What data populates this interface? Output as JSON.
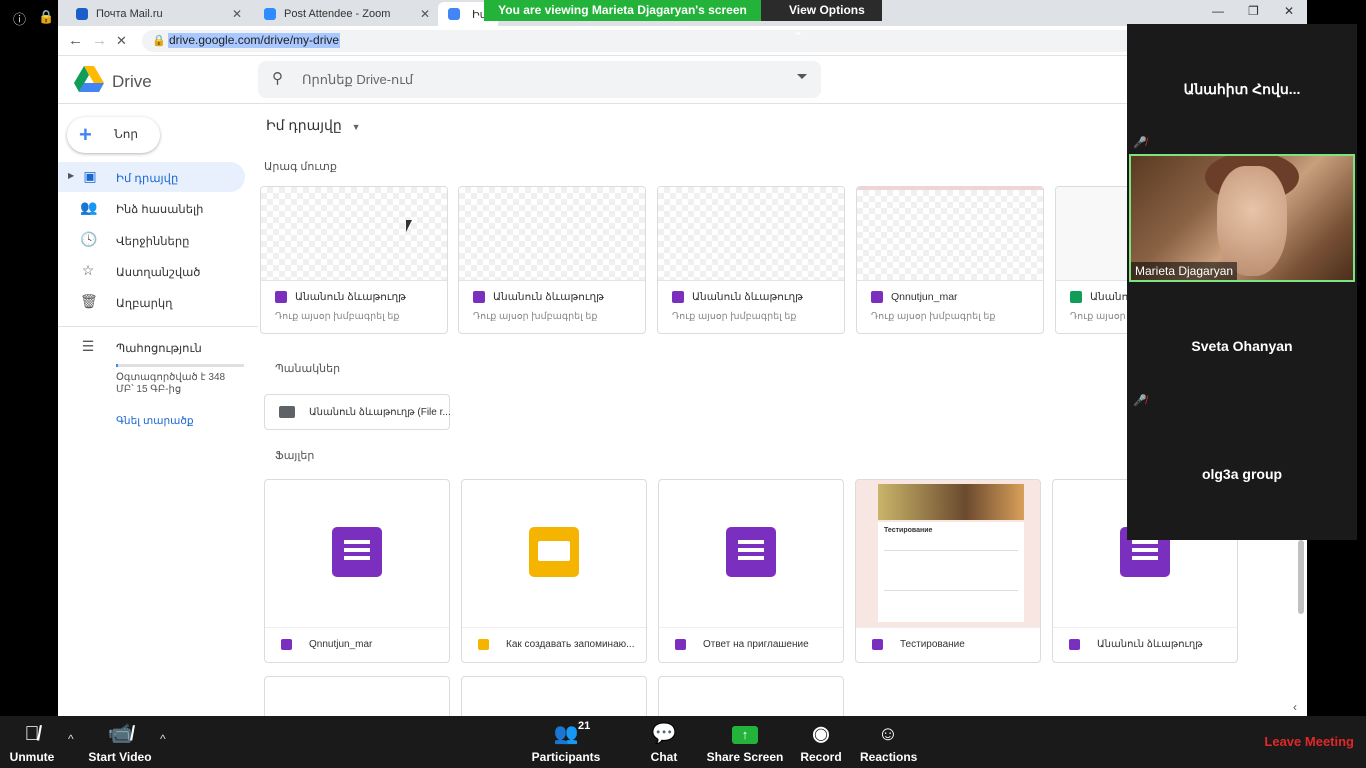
{
  "browser": {
    "tabs": [
      {
        "title": "Почта Mail.ru",
        "close": "✕",
        "color": "#1a5fc9"
      },
      {
        "title": "Post Attendee - Zoom",
        "close": "✕",
        "color": "#2d8cff"
      },
      {
        "title": "Իմ դ",
        "color": "#4285f4"
      }
    ],
    "window_controls": [
      "—",
      "❐",
      "✕"
    ],
    "back": "←",
    "forward": "→",
    "reload": "✕",
    "lock": "🔒",
    "url": "drive.google.com/drive/my-drive"
  },
  "zoom_banner": {
    "text": "You are viewing Marieta Djagaryan's screen",
    "view_options": "View Options",
    "chevron": "⌄"
  },
  "drive": {
    "logo_text": "Drive",
    "search_placeholder": "Որոնեք Drive-ում",
    "new_label": "Նոր",
    "breadcrumb": "Իմ դրայվը",
    "sidebar": [
      {
        "label": "Իմ դրայվը",
        "icon": "drive-icon",
        "glyph": "▣",
        "active": true
      },
      {
        "label": "Ինձ հասանելի",
        "icon": "people-icon",
        "glyph": "👥"
      },
      {
        "label": "Վերջինները",
        "icon": "clock-icon",
        "glyph": "🕓"
      },
      {
        "label": "Աստղանշված",
        "icon": "star-icon",
        "glyph": "☆"
      },
      {
        "label": "Աղբարկղ",
        "icon": "trash-icon",
        "glyph": "🗑"
      }
    ],
    "storage_label": "Պահոցություն",
    "storage_glyph": "☰",
    "storage_usage": "Օգտագործված է 348 ՄԲ՝ 15 ԳԲ-ից",
    "buy_storage": "Գնել տարածք",
    "quick_access_label": "Արագ մուտք",
    "quick_access": [
      {
        "name": "Անանուն ձևաթուղթ",
        "sub": "Դուք այսօր խմբագրել եք",
        "type": "forms"
      },
      {
        "name": "Անանուն ձևաթուղթ",
        "sub": "Դուք այսօր խմբագրել եք",
        "type": "forms"
      },
      {
        "name": "Անանուն ձևաթուղթ",
        "sub": "Դուք այսօր խմբագրել եք",
        "type": "forms"
      },
      {
        "name": "Qnnutjun_mar",
        "sub": "Դուք այսօր խմբագրել եք",
        "type": "forms"
      },
      {
        "name": "Անանու",
        "sub": "Դուք այսօր ըւ",
        "type": "sheets"
      }
    ],
    "folders_label": "Պանակներ",
    "folders": [
      {
        "name": "Անանուն ձևաթուղթ (File r..."
      }
    ],
    "files_label": "Ֆայլեր",
    "files": [
      {
        "name": "Qnnutjun_mar",
        "type": "forms"
      },
      {
        "name": "Как создавать запоминаю...",
        "type": "slides"
      },
      {
        "name": "Ответ на приглашение",
        "type": "forms"
      },
      {
        "name": "Тестирование",
        "type": "forms-preview"
      },
      {
        "name": "Անանուն ձևաթուղթ",
        "type": "forms"
      }
    ],
    "preview_title": "Тестирование"
  },
  "zoom_panel": {
    "participants": [
      {
        "name": "Անահիտ Հովս...",
        "muted": true
      },
      {
        "name": "Marieta Djagaryan",
        "video": true
      },
      {
        "name": "Sveta Ohanyan",
        "muted": true
      },
      {
        "name": "olg3a group"
      }
    ],
    "mute_glyph": "🎤̸"
  },
  "zoom_toolbar": {
    "unmute": "Unmute",
    "start_video": "Start Video",
    "participants": "Participants",
    "participants_count": "21",
    "chat": "Chat",
    "share_screen": "Share Screen",
    "record": "Record",
    "reactions": "Reactions",
    "leave": "Leave Meeting",
    "caret": "^"
  },
  "colors": {
    "zoom_green": "#23b33a",
    "leave_red": "#e02828",
    "forms_purple": "#7b2fbe",
    "slides_yellow": "#f4b400",
    "sheets_green": "#0f9d58",
    "drive_active": "#1967d2"
  }
}
